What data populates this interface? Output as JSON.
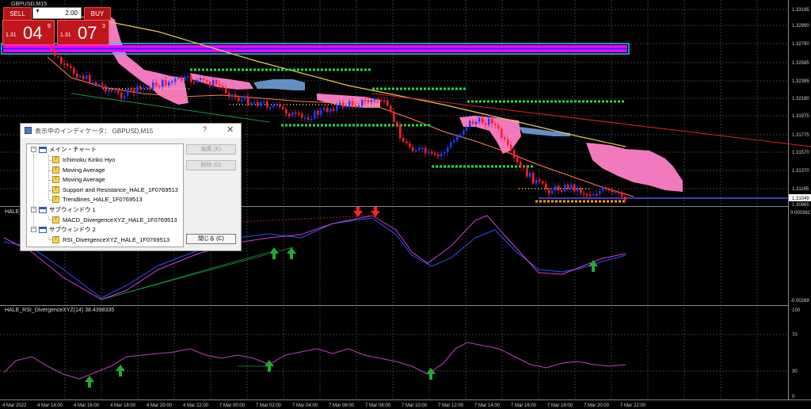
{
  "window": {
    "symbol_title": "GBPUSD,M15",
    "macd_title": "HALE_MACD",
    "rsi_title": "HALE_RSI_DivergenceXYZ(14) 38.4398335"
  },
  "trade_panel": {
    "sell_label": "SELL",
    "buy_label": "BUY",
    "lot": "2.00",
    "lot_arrow": "▼",
    "sell_small": "1.31",
    "sell_big": "04",
    "sell_sup": "9",
    "buy_small": "1.31",
    "buy_big": "07",
    "buy_sup": "3"
  },
  "price_axis": [
    "1.33195",
    "1.32990",
    "1.32790",
    "1.32585",
    "1.32385",
    "1.32180",
    "1.31975",
    "1.31775",
    "1.31570",
    "1.31370",
    "1.31165",
    "1.30965"
  ],
  "current_price": "1.31049",
  "macd_axis": [
    "0.000362",
    "-0.00269"
  ],
  "rsi_axis": [
    "100",
    "70",
    "30",
    "0"
  ],
  "time_axis": [
    "4 Mar 2022",
    "4 Mar 14:00",
    "4 Mar 16:00",
    "4 Mar 18:00",
    "4 Mar 20:00",
    "4 Mar 22:00",
    "7 Mar 00:00",
    "7 Mar 02:00",
    "7 Mar 04:00",
    "7 Mar 06:00",
    "7 Mar 08:00",
    "7 Mar 10:00",
    "7 Mar 12:00",
    "7 Mar 14:00",
    "7 Mar 16:00",
    "7 Mar 18:00",
    "7 Mar 20:00",
    "7 Mar 22:00"
  ],
  "dialog": {
    "title": "表示中のインディケータ： GBPUSD,M15",
    "help": "?",
    "close_x": "✕",
    "main_chart": "メイン・チャート",
    "indicators_main": [
      "Ichimoku Kinko Hyo",
      "Moving Average",
      "Moving Average",
      "Support and Resistance_HALE_1F0769513",
      "Trendlines_HALE_1F0769513"
    ],
    "subwindow1": "サブウィンドウ 1",
    "indicators_sub1": [
      "MACD_DivergenceXYZ_HALE_1F0769513"
    ],
    "subwindow2": "サブウィンドウ 2",
    "indicators_sub2": [
      "RSI_DivergenceXYZ_HALE_1F0769513"
    ],
    "edit_button": "編集 (E)",
    "delete_button": "削除 (D)",
    "close_button": "閉じる (C)"
  },
  "colors": {
    "background": "#000000",
    "grid": "#3a3a3a",
    "bull": "#1e3cff",
    "bear": "#ff1e28",
    "kumo": "#ff80c8",
    "ma_slow": "#e8c84a",
    "ma_fast": "#ff8050",
    "support": "#22dd44",
    "resistance_zone": "#ff00ff",
    "macd_main": "#3050ff",
    "macd_signal": "#d040d0",
    "rsi": "#c040c0"
  }
}
